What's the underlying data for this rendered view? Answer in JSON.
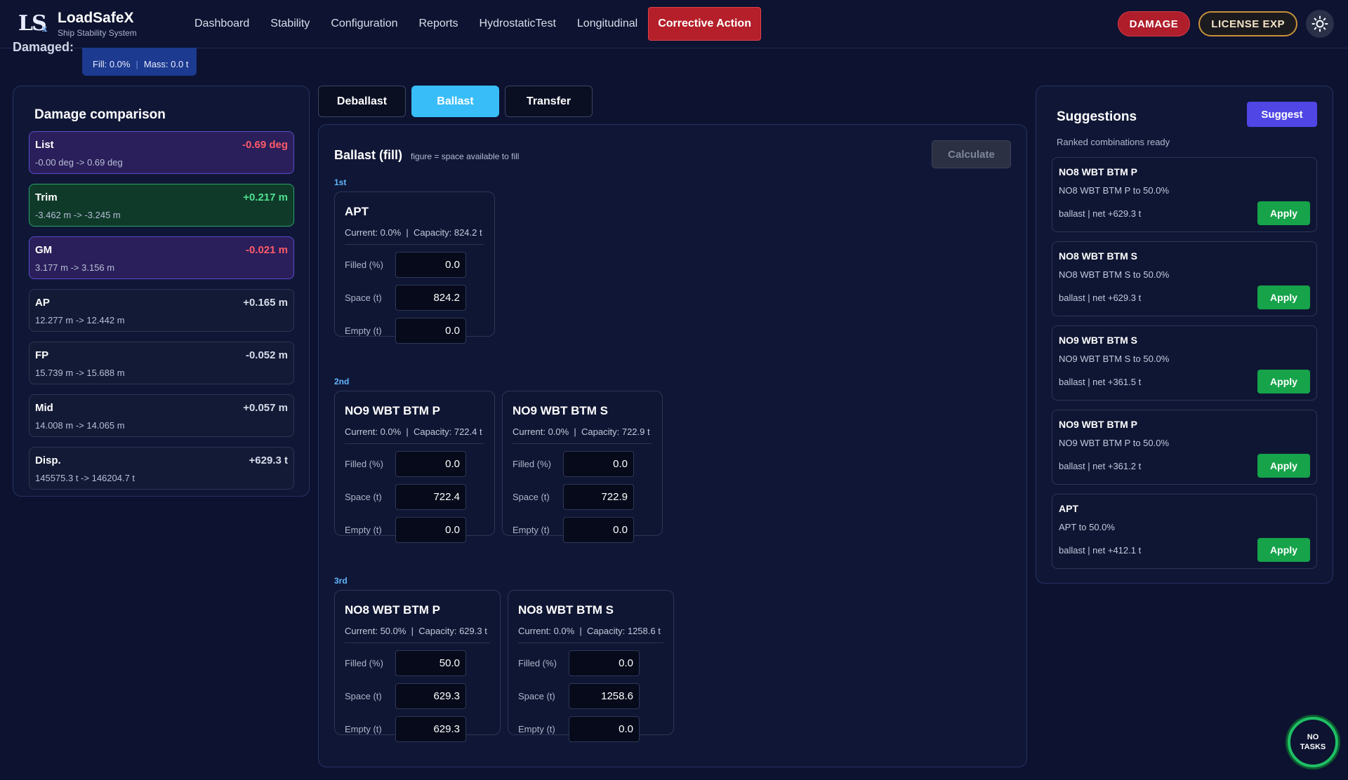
{
  "app": {
    "logo_main": "LS",
    "logo_sub": "x",
    "name": "LoadSafeX",
    "subtitle": "Ship Stability System"
  },
  "nav": {
    "items": [
      {
        "label": "Dashboard"
      },
      {
        "label": "Stability"
      },
      {
        "label": "Configuration"
      },
      {
        "label": "Reports"
      },
      {
        "label": "HydrostaticTest"
      },
      {
        "label": "Longitudinal"
      },
      {
        "label": "Corrective Action"
      }
    ],
    "active": "Corrective Action"
  },
  "badges": {
    "damage": "DAMAGE",
    "license": "LICENSE EXP",
    "theme_icon": "sun-icon"
  },
  "damaged_strip": {
    "label": "Damaged:",
    "fill": "Fill: 0.0%",
    "mass": "Mass: 0.0 t"
  },
  "comparison": {
    "title": "Damage comparison",
    "metrics": [
      {
        "name": "List",
        "delta": "-0.69 deg",
        "range": "-0.00 deg  ->  0.69 deg"
      },
      {
        "name": "Trim",
        "delta": "+0.217 m",
        "range": "-3.462 m  ->  -3.245 m"
      },
      {
        "name": "GM",
        "delta": "-0.021 m",
        "range": "3.177 m  ->  3.156 m"
      },
      {
        "name": "AP",
        "delta": "+0.165 m",
        "range": "12.277 m  ->  12.442 m"
      },
      {
        "name": "FP",
        "delta": "-0.052 m",
        "range": "15.739 m  ->  15.688 m"
      },
      {
        "name": "Mid",
        "delta": "+0.057 m",
        "range": "14.008 m  ->  14.065 m"
      },
      {
        "name": "Disp.",
        "delta": "+629.3 t",
        "range": "145575.3 t  ->  146204.7 t"
      }
    ]
  },
  "modes": {
    "tabs": [
      "Deballast",
      "Ballast",
      "Transfer"
    ],
    "active": "Ballast"
  },
  "ballast": {
    "title": "Ballast (fill)",
    "hint": "figure = space available to fill",
    "calculate_label": "Calculate",
    "field_labels": {
      "filled": "Filled (%)",
      "space": "Space (t)",
      "empty": "Empty (t)"
    },
    "groups": [
      {
        "label": "1st",
        "tanks": [
          {
            "name": "APT",
            "current": "Current: 0.0%",
            "capacity": "Capacity: 824.2 t",
            "filled": "0.0",
            "space": "824.2",
            "empty": "0.0"
          }
        ]
      },
      {
        "label": "2nd",
        "tanks": [
          {
            "name": "NO9 WBT BTM P",
            "current": "Current: 0.0%",
            "capacity": "Capacity: 722.4 t",
            "filled": "0.0",
            "space": "722.4",
            "empty": "0.0"
          },
          {
            "name": "NO9 WBT BTM S",
            "current": "Current: 0.0%",
            "capacity": "Capacity: 722.9 t",
            "filled": "0.0",
            "space": "722.9",
            "empty": "0.0"
          }
        ]
      },
      {
        "label": "3rd",
        "tanks": [
          {
            "name": "NO8 WBT BTM P",
            "current": "Current: 50.0%",
            "capacity": "Capacity: 629.3 t",
            "filled": "50.0",
            "space": "629.3",
            "empty": "629.3"
          },
          {
            "name": "NO8 WBT BTM S",
            "current": "Current: 0.0%",
            "capacity": "Capacity: 1258.6 t",
            "filled": "0.0",
            "space": "1258.6",
            "empty": "0.0"
          }
        ]
      }
    ]
  },
  "suggestions": {
    "title": "Suggestions",
    "button": "Suggest",
    "status": "Ranked combinations ready",
    "apply_label": "Apply",
    "items": [
      {
        "name": "NO8 WBT BTM P",
        "desc": "NO8 WBT BTM P to 50.0%",
        "net": "ballast | net +629.3 t"
      },
      {
        "name": "NO8 WBT BTM S",
        "desc": "NO8 WBT BTM S to 50.0%",
        "net": "ballast | net +629.3 t"
      },
      {
        "name": "NO9 WBT BTM S",
        "desc": "NO9 WBT BTM S to 50.0%",
        "net": "ballast | net +361.5 t"
      },
      {
        "name": "NO9 WBT BTM P",
        "desc": "NO9 WBT BTM P to 50.0%",
        "net": "ballast | net +361.2 t"
      },
      {
        "name": "APT",
        "desc": "APT to 50.0%",
        "net": "ballast | net +412.1 t"
      }
    ]
  },
  "tasks": {
    "line1": "NO",
    "line2": "TASKS"
  },
  "colors": {
    "background": "#0c1230",
    "danger": "#b41f2a",
    "accent": "#38bdf8",
    "suggest": "#4f46e5",
    "apply": "#16a34a",
    "positive": "#4ee08f",
    "negative": "#ff5a6a"
  }
}
